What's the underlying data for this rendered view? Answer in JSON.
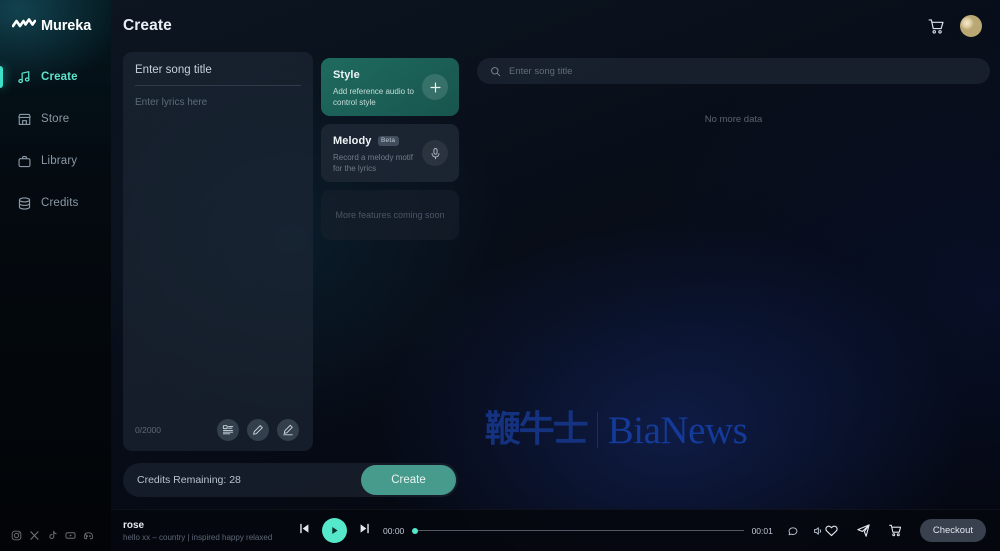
{
  "brand": {
    "name": "Mureka",
    "logo_icon": "waveform-zigzag-icon"
  },
  "sidebar": {
    "items": [
      {
        "label": "Create",
        "icon": "music-note-icon",
        "active": true
      },
      {
        "label": "Store",
        "icon": "store-icon",
        "active": false
      },
      {
        "label": "Library",
        "icon": "briefcase-icon",
        "active": false
      },
      {
        "label": "Credits",
        "icon": "database-icon",
        "active": false
      }
    ],
    "socials": [
      {
        "name": "instagram-icon"
      },
      {
        "name": "x-twitter-icon"
      },
      {
        "name": "tiktok-icon"
      },
      {
        "name": "youtube-icon"
      },
      {
        "name": "discord-icon"
      }
    ]
  },
  "header": {
    "title": "Create",
    "cart_icon": "cart-icon",
    "avatar_label": "user-avatar"
  },
  "editor": {
    "title_placeholder": "Enter song title",
    "lyrics_placeholder": "Enter lyrics here",
    "char_count": "0/2000",
    "tools": [
      {
        "name": "lyrics-structure-icon"
      },
      {
        "name": "edit-pencil-icon"
      },
      {
        "name": "ai-write-pencil-icon"
      }
    ]
  },
  "cards": {
    "style": {
      "title": "Style",
      "description": "Add reference audio to control style",
      "action_icon": "plus-icon",
      "accent": "#1f6a5f"
    },
    "melody": {
      "title": "Melody",
      "badge": "Beta",
      "description": "Record a melody motif for the lyrics",
      "action_icon": "microphone-icon"
    },
    "coming_soon": {
      "text": "More features coming soon"
    }
  },
  "credits": {
    "label": "Credits Remaining: 28",
    "create_button": "Create",
    "create_color": "#479b8c"
  },
  "library": {
    "search_placeholder": "Enter song title",
    "search_icon": "search-icon",
    "empty_text": "No more data"
  },
  "watermark": {
    "cn": "鞭牛士",
    "en": "BiaNews",
    "color": "#14327f"
  },
  "player": {
    "track_title": "rose",
    "track_subtitle": "hello xx – country | inspired happy relaxed",
    "prev_icon": "skip-previous-icon",
    "play_icon": "play-icon",
    "next_icon": "skip-next-icon",
    "current_time": "00:00",
    "total_time": "00:01",
    "progress_percent": 0,
    "repeat_icon": "repeat-icon",
    "volume_icon": "volume-icon",
    "like_icon": "heart-icon",
    "share_icon": "share-paper-plane-icon",
    "cart_icon": "cart-icon",
    "checkout_label": "Checkout",
    "accent": "#55e8ca"
  }
}
